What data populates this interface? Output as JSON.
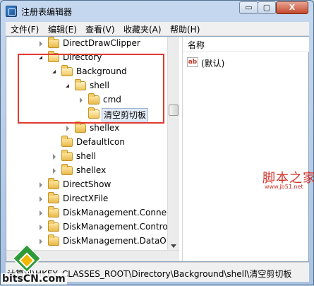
{
  "window": {
    "title": "注册表编辑器",
    "controls": {
      "minimize": "▭",
      "maximize": "▢",
      "close": "X"
    }
  },
  "menu": [
    "文件(F)",
    "编辑(E)",
    "查看(V)",
    "收藏夹(A)",
    "帮助(H)"
  ],
  "tree": {
    "items": [
      {
        "label": "DirectDrawClipper",
        "expander": "collapsed"
      },
      {
        "label": "Directory",
        "expander": "expanded"
      },
      {
        "label": "Background",
        "expander": "expanded"
      },
      {
        "label": "shell",
        "expander": "expanded"
      },
      {
        "label": "cmd",
        "expander": "collapsed"
      },
      {
        "label": "清空剪切板",
        "expander": "none",
        "selected": true
      },
      {
        "label": "shellex",
        "expander": "collapsed"
      },
      {
        "label": "DefaultIcon",
        "expander": "none"
      },
      {
        "label": "shell",
        "expander": "collapsed"
      },
      {
        "label": "shellex",
        "expander": "collapsed"
      },
      {
        "label": "DirectShow",
        "expander": "collapsed"
      },
      {
        "label": "DirectXFile",
        "expander": "collapsed"
      },
      {
        "label": "DiskManagement.Connec",
        "expander": "collapsed"
      },
      {
        "label": "DiskManagement.Contro",
        "expander": "collapsed"
      },
      {
        "label": "DiskManagement.DataOl",
        "expander": "collapsed"
      }
    ]
  },
  "values": {
    "column_name": "名称",
    "rows": [
      {
        "icon": "ab",
        "name": "(默认)"
      }
    ]
  },
  "statusbar": {
    "path": "计算机\\HKEY_CLASSES_ROOT\\Directory\\Background\\shell\\清空剪切板"
  },
  "watermark": {
    "cn": "脚本之家",
    "url": "www.jb51.net"
  },
  "logo": {
    "text": "bitsCN.com"
  },
  "colors": {
    "highlight_box": "#e03a2f",
    "title_bar": "#aac3e2",
    "folder": "#f0c75e"
  }
}
